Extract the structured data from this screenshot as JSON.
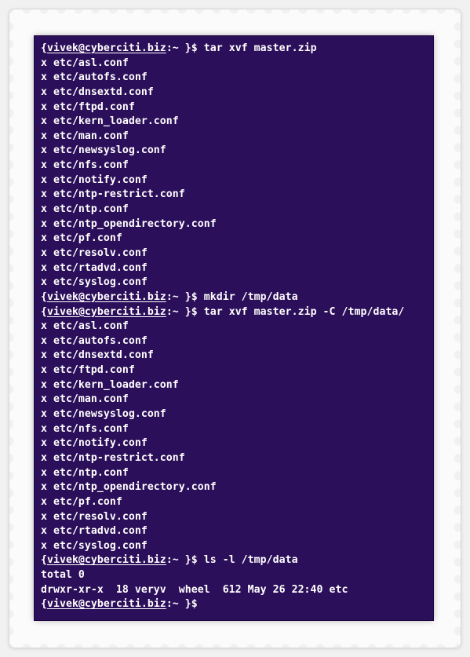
{
  "terminal": {
    "background_color": "#2c0f5a",
    "text_color": "#ffffff",
    "prompt_user": "vivek@cyberciti.biz",
    "lines": [
      {
        "type": "prompt",
        "cmd": "tar xvf master.zip"
      },
      {
        "type": "output",
        "text": "x etc/asl.conf"
      },
      {
        "type": "output",
        "text": "x etc/autofs.conf"
      },
      {
        "type": "output",
        "text": "x etc/dnsextd.conf"
      },
      {
        "type": "output",
        "text": "x etc/ftpd.conf"
      },
      {
        "type": "output",
        "text": "x etc/kern_loader.conf"
      },
      {
        "type": "output",
        "text": "x etc/man.conf"
      },
      {
        "type": "output",
        "text": "x etc/newsyslog.conf"
      },
      {
        "type": "output",
        "text": "x etc/nfs.conf"
      },
      {
        "type": "output",
        "text": "x etc/notify.conf"
      },
      {
        "type": "output",
        "text": "x etc/ntp-restrict.conf"
      },
      {
        "type": "output",
        "text": "x etc/ntp.conf"
      },
      {
        "type": "output",
        "text": "x etc/ntp_opendirectory.conf"
      },
      {
        "type": "output",
        "text": "x etc/pf.conf"
      },
      {
        "type": "output",
        "text": "x etc/resolv.conf"
      },
      {
        "type": "output",
        "text": "x etc/rtadvd.conf"
      },
      {
        "type": "output",
        "text": "x etc/syslog.conf"
      },
      {
        "type": "prompt",
        "cmd": "mkdir /tmp/data"
      },
      {
        "type": "prompt",
        "cmd": "tar xvf master.zip -C /tmp/data/"
      },
      {
        "type": "output",
        "text": "x etc/asl.conf"
      },
      {
        "type": "output",
        "text": "x etc/autofs.conf"
      },
      {
        "type": "output",
        "text": "x etc/dnsextd.conf"
      },
      {
        "type": "output",
        "text": "x etc/ftpd.conf"
      },
      {
        "type": "output",
        "text": "x etc/kern_loader.conf"
      },
      {
        "type": "output",
        "text": "x etc/man.conf"
      },
      {
        "type": "output",
        "text": "x etc/newsyslog.conf"
      },
      {
        "type": "output",
        "text": "x etc/nfs.conf"
      },
      {
        "type": "output",
        "text": "x etc/notify.conf"
      },
      {
        "type": "output",
        "text": "x etc/ntp-restrict.conf"
      },
      {
        "type": "output",
        "text": "x etc/ntp.conf"
      },
      {
        "type": "output",
        "text": "x etc/ntp_opendirectory.conf"
      },
      {
        "type": "output",
        "text": "x etc/pf.conf"
      },
      {
        "type": "output",
        "text": "x etc/resolv.conf"
      },
      {
        "type": "output",
        "text": "x etc/rtadvd.conf"
      },
      {
        "type": "output",
        "text": "x etc/syslog.conf"
      },
      {
        "type": "prompt",
        "cmd": "ls -l /tmp/data"
      },
      {
        "type": "output",
        "text": "total 0"
      },
      {
        "type": "output",
        "text": "drwxr-xr-x  18 veryv  wheel  612 May 26 22:40 etc"
      },
      {
        "type": "prompt",
        "cmd": ""
      }
    ]
  }
}
